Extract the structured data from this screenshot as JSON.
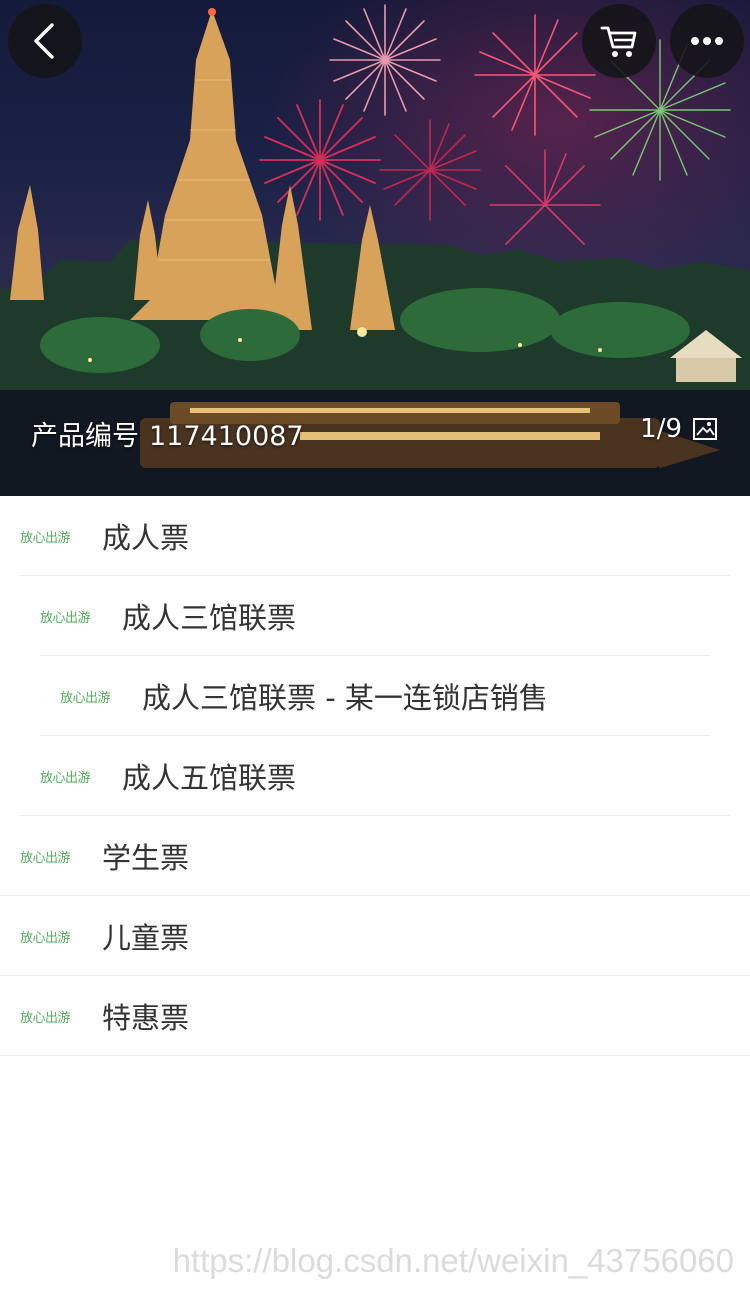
{
  "hero": {
    "product_code_label": "产品编号",
    "product_code": "117410087",
    "image_counter": "1/9"
  },
  "icons": {
    "back": "chevron-left-icon",
    "cart": "shopping-cart-icon",
    "more": "more-dots-icon",
    "gallery": "image-icon"
  },
  "badge_text": "放心出游",
  "tickets": [
    {
      "label": "成人票",
      "level": 0
    },
    {
      "label": "成人三馆联票",
      "level": 1
    },
    {
      "label": "成人三馆联票 - 某一连锁店销售",
      "level": 2
    },
    {
      "label": "成人五馆联票",
      "level": 1
    },
    {
      "label": "学生票",
      "level": 0
    },
    {
      "label": "儿童票",
      "level": 0
    },
    {
      "label": "特惠票",
      "level": 0
    }
  ],
  "watermark": "https://blog.csdn.net/weixin_43756060",
  "colors": {
    "badge_green": "#4fae5a",
    "badge_heart": "#e64646",
    "text": "#333333",
    "divider": "#ececec"
  }
}
